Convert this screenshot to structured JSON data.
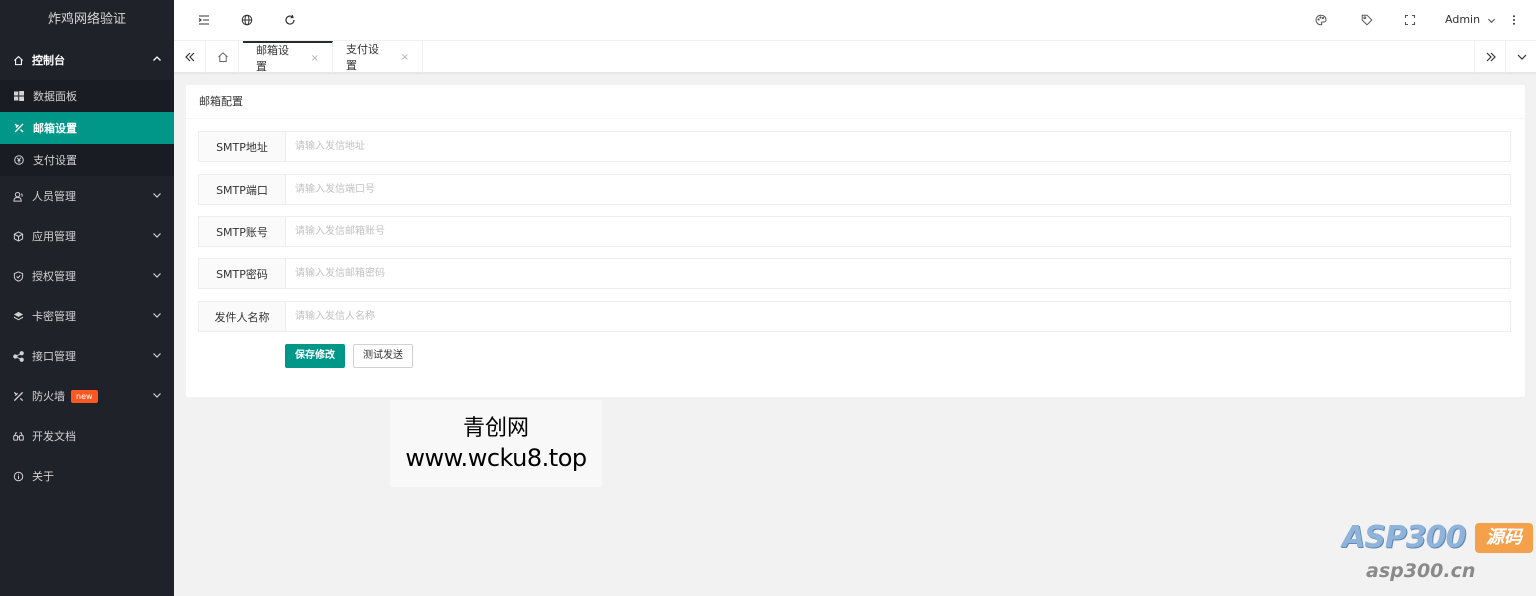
{
  "app": {
    "title": "炸鸡网络验证"
  },
  "sidebar": {
    "console": {
      "label": "控制台"
    },
    "console_items": [
      {
        "label": "数据面板"
      },
      {
        "label": "邮箱设置"
      },
      {
        "label": "支付设置"
      }
    ],
    "menu": [
      {
        "label": "人员管理"
      },
      {
        "label": "应用管理"
      },
      {
        "label": "授权管理"
      },
      {
        "label": "卡密管理"
      },
      {
        "label": "接口管理"
      },
      {
        "label": "防火墙",
        "badge": "new"
      },
      {
        "label": "开发文档"
      },
      {
        "label": "关于"
      }
    ]
  },
  "header": {
    "user": "Admin"
  },
  "tabs": [
    {
      "label": "邮箱设置"
    },
    {
      "label": "支付设置"
    }
  ],
  "tab_close": "×",
  "card": {
    "title": "邮箱配置",
    "fields": [
      {
        "label": "SMTP地址",
        "placeholder": "请输入发信地址"
      },
      {
        "label": "SMTP端口",
        "placeholder": "请输入发信端口号"
      },
      {
        "label": "SMTP账号",
        "placeholder": "请输入发信邮箱账号"
      },
      {
        "label": "SMTP密码",
        "placeholder": "请输入发信邮箱密码"
      },
      {
        "label": "发件人名称",
        "placeholder": "请输入发信人名称"
      }
    ],
    "save_label": "保存修改",
    "test_label": "测试发送"
  },
  "watermark": {
    "line1": "青创网",
    "line2": "www.wcku8.top",
    "brand": "ASP300",
    "brand_tag": "源码",
    "brand_url": "asp300.cn"
  },
  "colors": {
    "accent": "#009688",
    "sidebar_bg": "#20222a",
    "badge": "#ff5722"
  }
}
